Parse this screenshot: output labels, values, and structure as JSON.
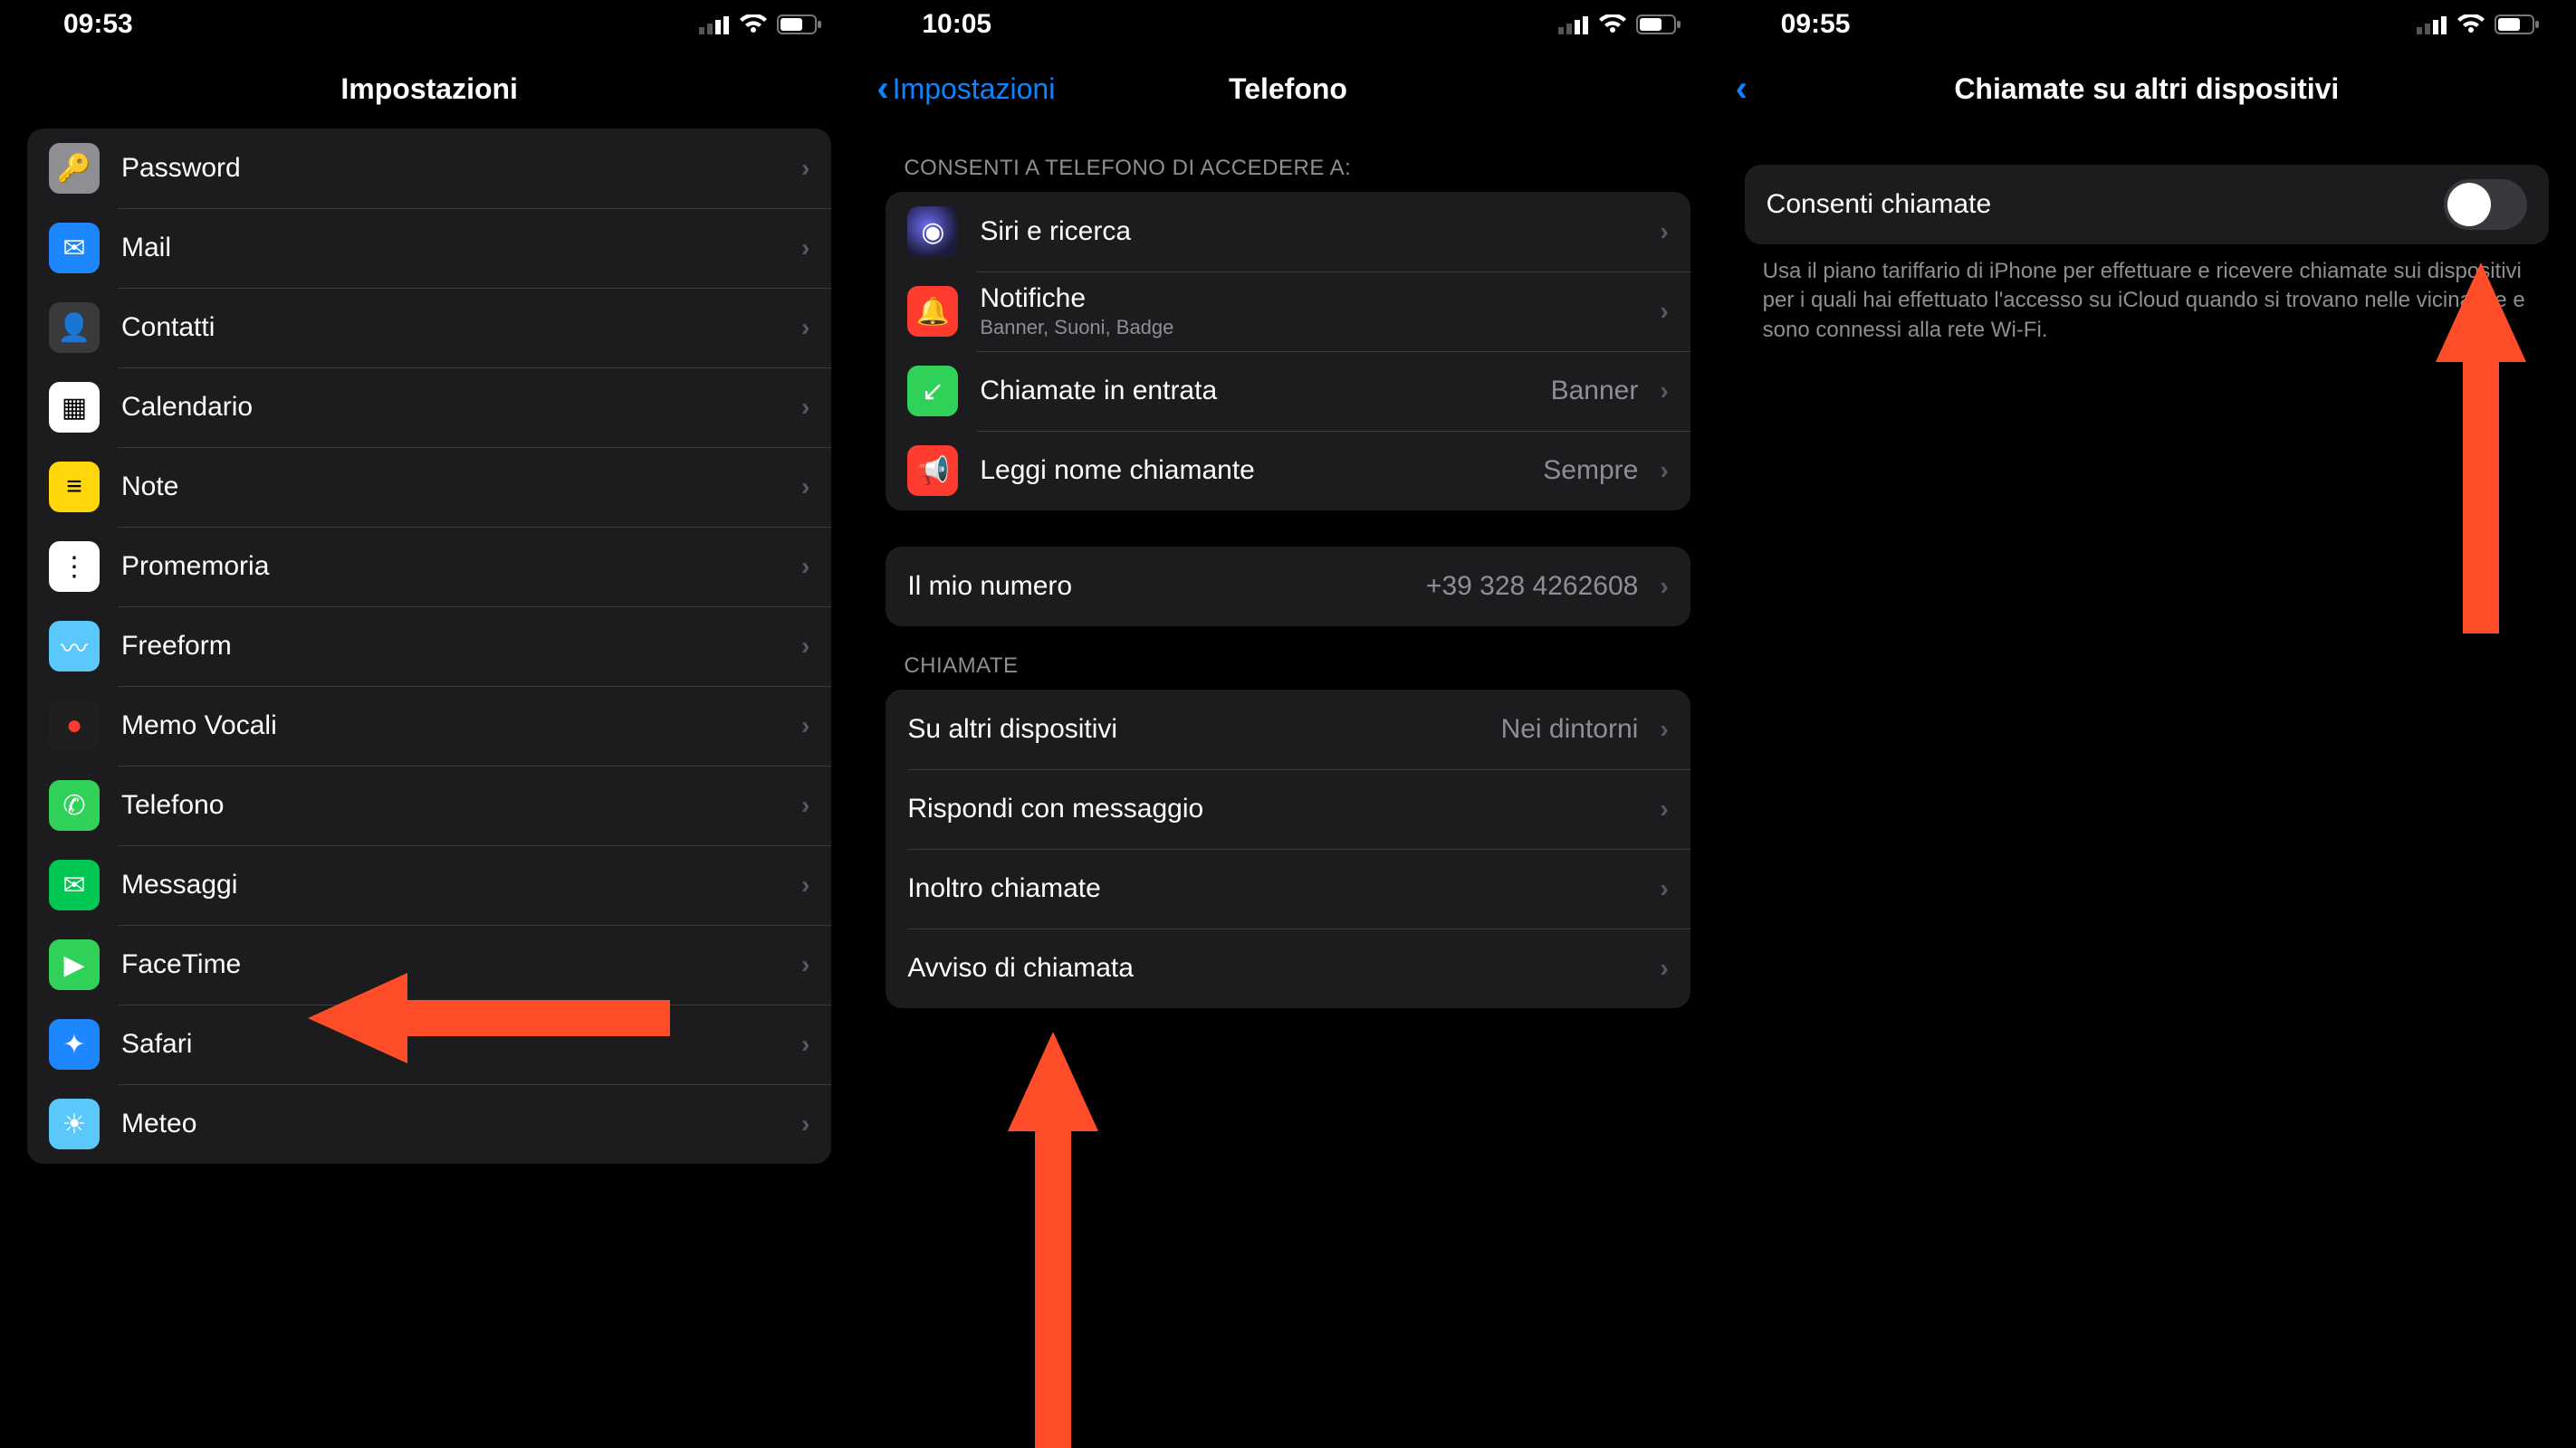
{
  "status": {
    "time1": "09:53",
    "time2": "10:05",
    "time3": "09:55"
  },
  "phone1": {
    "title": "Impostazioni",
    "items": [
      {
        "name": "Password",
        "icon": "key-icon",
        "color": "bg-grey"
      },
      {
        "name": "Mail",
        "icon": "mail-icon",
        "color": "bg-blue"
      },
      {
        "name": "Contatti",
        "icon": "contact-icon",
        "color": "bg-grey2"
      },
      {
        "name": "Calendario",
        "icon": "calendar-icon",
        "color": "bg-white"
      },
      {
        "name": "Note",
        "icon": "notes-icon",
        "color": "bg-yellow"
      },
      {
        "name": "Promemoria",
        "icon": "reminders-icon",
        "color": "bg-white"
      },
      {
        "name": "Freeform",
        "icon": "freeform-icon",
        "color": "bg-teal"
      },
      {
        "name": "Memo Vocali",
        "icon": "voicememo-icon",
        "color": "bg-dark"
      },
      {
        "name": "Telefono",
        "icon": "phone-icon",
        "color": "bg-green"
      },
      {
        "name": "Messaggi",
        "icon": "messages-icon",
        "color": "bg-green2"
      },
      {
        "name": "FaceTime",
        "icon": "facetime-icon",
        "color": "bg-green"
      },
      {
        "name": "Safari",
        "icon": "safari-icon",
        "color": "bg-blue"
      },
      {
        "name": "Meteo",
        "icon": "weather-icon",
        "color": "bg-teal"
      }
    ]
  },
  "phone2": {
    "back": "Impostazioni",
    "title": "Telefono",
    "section1_header": "Consenti a Telefono di accedere a:",
    "section1": [
      {
        "name": "Siri e ricerca",
        "icon": "siri-icon",
        "color": "bg-siri",
        "sub": ""
      },
      {
        "name": "Notifiche",
        "icon": "bell-icon",
        "color": "bg-red",
        "sub": "Banner, Suoni, Badge"
      },
      {
        "name": "Chiamate in entrata",
        "icon": "incoming-call-icon",
        "color": "bg-green",
        "detail": "Banner"
      },
      {
        "name": "Leggi nome chiamante",
        "icon": "announce-icon",
        "color": "bg-red",
        "detail": "Sempre"
      }
    ],
    "my_number_label": "Il mio numero",
    "my_number_value": "+39 328 4262608",
    "section2_header": "Chiamate",
    "section2": [
      {
        "name": "Su altri dispositivi",
        "detail": "Nei dintorni"
      },
      {
        "name": "Rispondi con messaggio",
        "detail": ""
      },
      {
        "name": "Inoltro chiamate",
        "detail": ""
      },
      {
        "name": "Avviso di chiamata",
        "detail": ""
      }
    ]
  },
  "phone3": {
    "title": "Chiamate su altri dispositivi",
    "toggle_label": "Consenti chiamate",
    "footer": "Usa il piano tariffario di iPhone per effettuare e ricevere chiamate sui dispositivi per i quali hai effettuato l'accesso su iCloud quando si trovano nelle vicinanze e sono connessi alla rete Wi-Fi."
  },
  "arrow_color": "#ff4d29"
}
